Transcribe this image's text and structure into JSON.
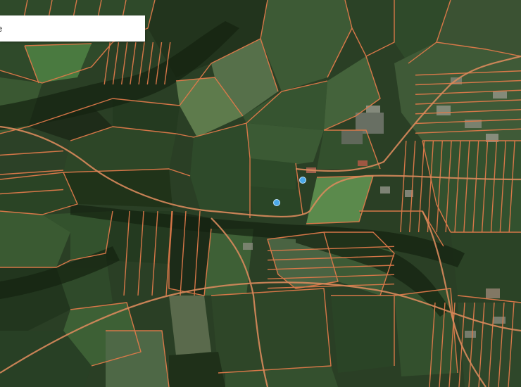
{
  "map": {
    "style": "satellite with cadastral parcel boundaries",
    "parcel_line_color": "#e07a4a",
    "field_colors": [
      "#2f4a2a",
      "#3a5832",
      "#26391f",
      "#446b3a",
      "#4f7a44",
      "#1c2a18",
      "#567a4a",
      "#3d5a35"
    ],
    "marker_color": "#4aa8e8",
    "markers": [
      {
        "name": "location-pin-north"
      },
      {
        "name": "location-pin-south"
      }
    ]
  },
  "search": {
    "value": "e",
    "placeholder": ""
  }
}
